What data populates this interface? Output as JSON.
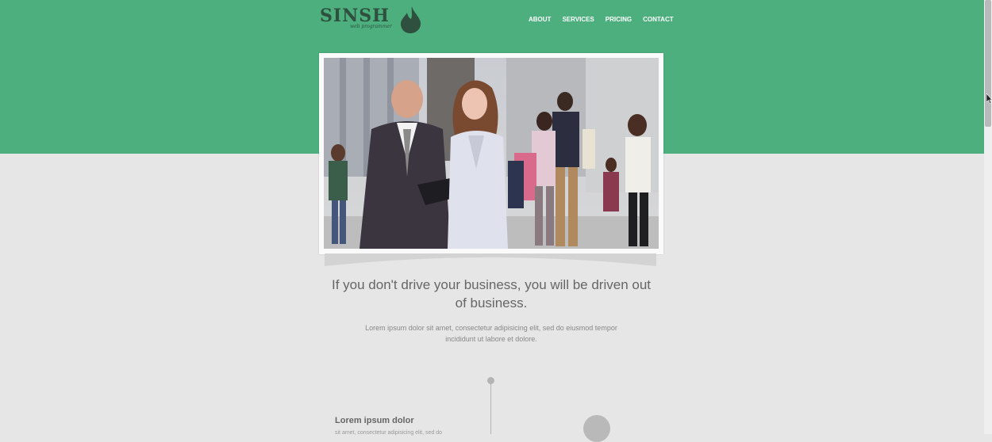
{
  "logo": {
    "name": "SINSH",
    "tagline": "web programmer"
  },
  "nav": {
    "items": [
      "ABOUT",
      "SERVICES",
      "PRICING",
      "CONTACT"
    ]
  },
  "hero": {
    "headline": "If you don't drive your business, you will be driven out of business.",
    "subtext": "Lorem ipsum dolor sit amet, consectetur adipisicing elit, sed do eiusmod tempor incididunt ut labore et dolore."
  },
  "feature": {
    "title": "Lorem ipsum dolor",
    "text": "sit amet, consectetur adipisicing elit, sed do"
  },
  "colors": {
    "brand_green": "#4caf7d",
    "background": "#e6e6e6",
    "logo_dark": "#2f4f3f"
  }
}
